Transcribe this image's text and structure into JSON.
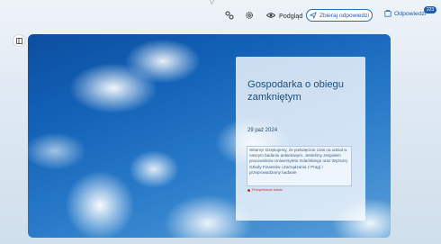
{
  "topbar": {
    "preview_label": "Podgląd",
    "collect_label": "Zbieraj odpowiedzi",
    "responses_label": "Odpowiedzi",
    "responses_count": "223"
  },
  "card": {
    "title": "Gospodarka o obiegu zamkniętym",
    "date": "29 paź 2024",
    "description": "Witamy! Dziękujemy, że poświęcicie czas na udział w naszym badaniu ankietowym. Jesteśmy zespołem pracowników Uniwersytetu Gdańskiego oraz Wyższej Szkoły Finansów i Zarządzania z Prag) i przeprowadzamy badanie",
    "error_text": "Przepełnienie tekstu"
  },
  "icons": {
    "share": "share-icon",
    "settings": "gear-icon",
    "preview": "eye-icon",
    "collect": "send-icon",
    "responses": "responses-icon",
    "sidebar": "sidebar-toggle-icon"
  }
}
